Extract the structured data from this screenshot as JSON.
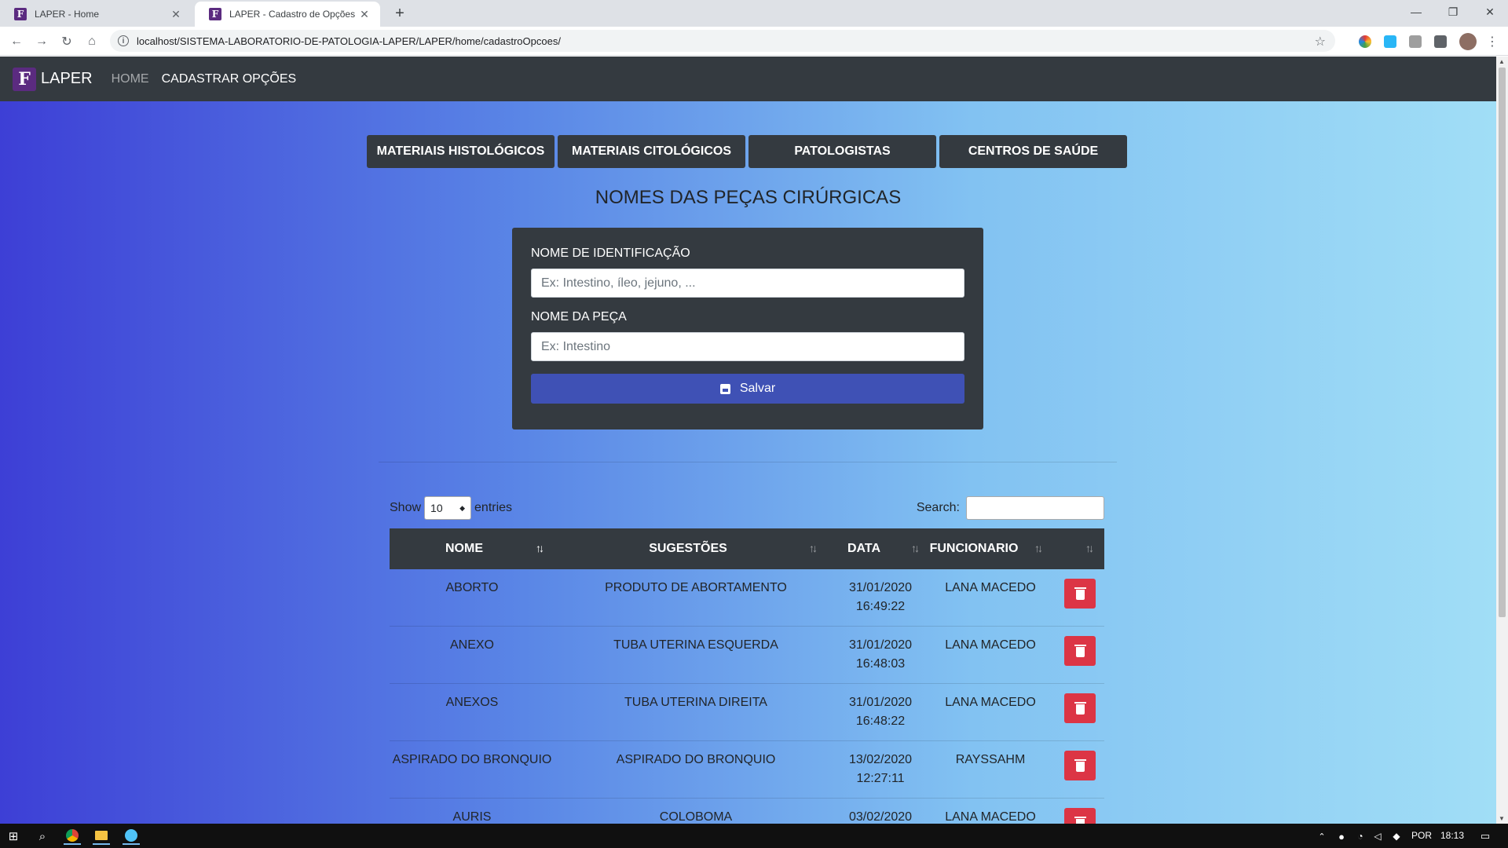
{
  "browser": {
    "tabs": [
      {
        "title": "LAPER - Home",
        "active": false
      },
      {
        "title": "LAPER - Cadastro de Opções",
        "active": true
      }
    ],
    "url": "localhost/SISTEMA-LABORATORIO-DE-PATOLOGIA-LAPER/LAPER/home/cadastroOpcoes/"
  },
  "navbar": {
    "brand": "LAPER",
    "links": [
      "HOME",
      "CADASTRAR OPÇÕES"
    ]
  },
  "option_tabs": [
    "MATERIAIS HISTOLÓGICOS",
    "MATERIAIS CITOLÓGICOS",
    "PATOLOGISTAS",
    "CENTROS DE SAÚDE"
  ],
  "section_title": "NOMES DAS PEÇAS CIRÚRGICAS",
  "form": {
    "id_label": "NOME DE IDENTIFICAÇÃO",
    "id_placeholder": "Ex: Intestino, íleo, jejuno, ...",
    "piece_label": "NOME DA PEÇA",
    "piece_placeholder": "Ex: Intestino",
    "save_label": "Salvar"
  },
  "table": {
    "show_label": "Show",
    "entries_label": "entries",
    "page_length": "10",
    "search_label": "Search:",
    "columns": [
      "NOME",
      "SUGESTÕES",
      "DATA",
      "FUNCIONARIO"
    ],
    "rows": [
      {
        "nome": "ABORTO",
        "sugestoes": "PRODUTO DE ABORTAMENTO",
        "data": "31/01/2020",
        "hora": "16:49:22",
        "funcionario": "LANA MACEDO"
      },
      {
        "nome": "ANEXO",
        "sugestoes": "TUBA UTERINA ESQUERDA",
        "data": "31/01/2020",
        "hora": "16:48:03",
        "funcionario": "LANA MACEDO"
      },
      {
        "nome": "ANEXOS",
        "sugestoes": "TUBA UTERINA DIREITA",
        "data": "31/01/2020",
        "hora": "16:48:22",
        "funcionario": "LANA MACEDO"
      },
      {
        "nome": "ASPIRADO DO BRONQUIO",
        "sugestoes": "ASPIRADO DO BRONQUIO",
        "data": "13/02/2020",
        "hora": "12:27:11",
        "funcionario": "RAYSSAHM"
      },
      {
        "nome": "AURIS",
        "sugestoes": "COLOBOMA",
        "data": "03/02/2020",
        "hora": "",
        "funcionario": "LANA MACEDO"
      }
    ]
  },
  "taskbar": {
    "language": "POR",
    "time": "18:13"
  },
  "colors": {
    "navbar": "#343a40",
    "save_button": "#3f51b5",
    "delete_button": "#dc3545",
    "brand_logo": "#5b2b80"
  }
}
